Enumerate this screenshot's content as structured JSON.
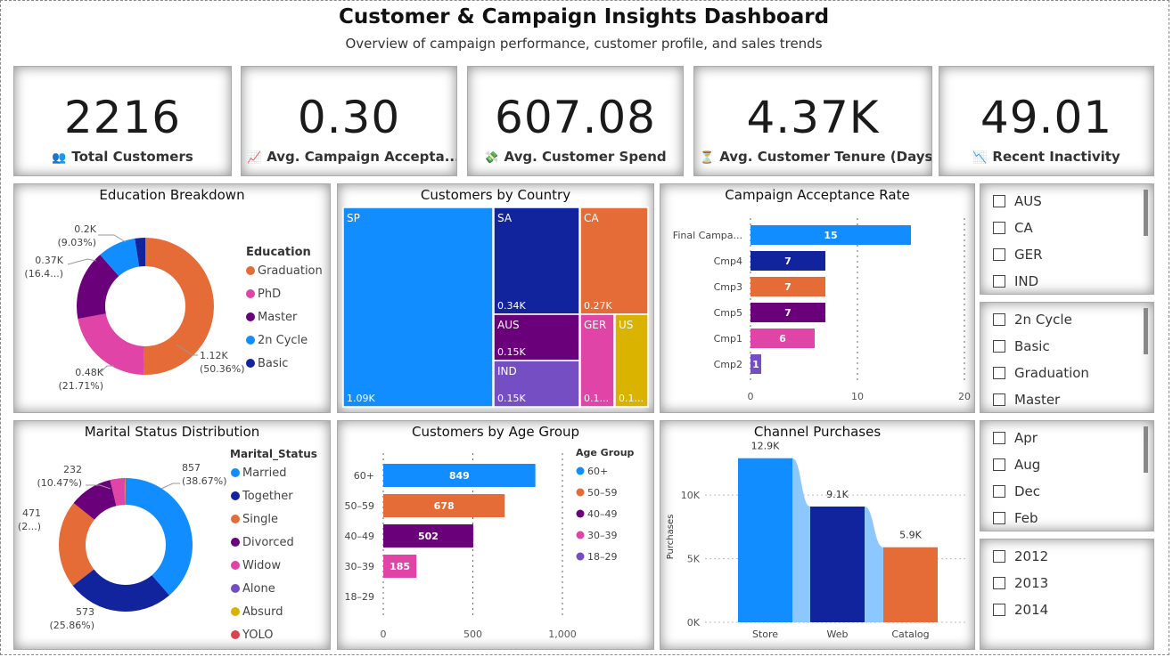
{
  "header": {
    "title": "Customer & Campaign Insights Dashboard",
    "subtitle": "Overview of campaign performance, customer profile, and sales trends"
  },
  "kpis": [
    {
      "value": "2216",
      "label": "Total Customers",
      "icon": "people-icon",
      "color": "#5b3a8c"
    },
    {
      "value": "0.30",
      "label": "Avg. Campaign Accepta...",
      "icon": "line-chart-icon",
      "color": "#4a78c9"
    },
    {
      "value": "607.08",
      "label": "Avg. Customer Spend",
      "icon": "money-icon",
      "color": "#3a9a3a"
    },
    {
      "value": "4.37K",
      "label": "Avg. Customer Tenure (Days)",
      "icon": "hourglass-icon",
      "color": "#c89b2a"
    },
    {
      "value": "49.01",
      "label": "Recent Inactivity",
      "icon": "trend-down-icon",
      "color": "#c0457a"
    }
  ],
  "education": {
    "title": "Education Breakdown",
    "legend_title": "Education",
    "legend": [
      "Graduation",
      "PhD",
      "Master",
      "2n Cycle",
      "Basic"
    ],
    "labels": [
      {
        "value": "1.12K",
        "pct": "(50.36%)"
      },
      {
        "value": "0.48K",
        "pct": "(21.71%)"
      },
      {
        "value": "0.37K",
        "pct": "(16.4...)"
      },
      {
        "value": "0.2K",
        "pct": "(9.03%)"
      }
    ],
    "chart_data": {
      "type": "pie",
      "categories": [
        "Graduation",
        "PhD",
        "Master",
        "2n Cycle",
        "Basic"
      ],
      "values": [
        1116,
        481,
        365,
        200,
        54
      ],
      "colors": [
        "#e66c37",
        "#e044a7",
        "#6b007b",
        "#118dff",
        "#12239e"
      ]
    }
  },
  "country": {
    "title": "Customers by Country",
    "chart_data": {
      "type": "treemap",
      "categories": [
        "SP",
        "SA",
        "CA",
        "AUS",
        "IND",
        "GER",
        "US"
      ],
      "labels": [
        "1.09K",
        "0.34K",
        "0.27K",
        "0.15K",
        "0.15K",
        "0.1...",
        "0.1..."
      ],
      "values": [
        1095,
        337,
        268,
        160,
        148,
        120,
        109
      ]
    }
  },
  "campaign": {
    "title": "Campaign Acceptance Rate",
    "chart_data": {
      "type": "bar",
      "categories": [
        "Final Campa...",
        "Cmp4",
        "Cmp3",
        "Cmp5",
        "Cmp1",
        "Cmp2"
      ],
      "values": [
        15,
        7,
        7,
        7,
        6,
        1
      ],
      "xticks": [
        "0",
        "10",
        "20"
      ],
      "xlim": [
        0,
        20
      ],
      "colors": [
        "#118dff",
        "#12239e",
        "#e66c37",
        "#6b007b",
        "#e044a7",
        "#744ec2"
      ]
    }
  },
  "slicer_country": {
    "items": [
      "AUS",
      "CA",
      "GER",
      "IND"
    ]
  },
  "slicer_education": {
    "items": [
      "2n Cycle",
      "Basic",
      "Graduation",
      "Master"
    ]
  },
  "slicer_month": {
    "items": [
      "Apr",
      "Aug",
      "Dec",
      "Feb"
    ]
  },
  "slicer_year": {
    "items": [
      "2012",
      "2013",
      "2014"
    ]
  },
  "marital": {
    "title": "Marital Status Distribution",
    "legend_title": "Marital_Status",
    "legend": [
      "Married",
      "Together",
      "Single",
      "Divorced",
      "Widow",
      "Alone",
      "Absurd",
      "YOLO"
    ],
    "legend_colors": [
      "#118dff",
      "#12239e",
      "#e66c37",
      "#6b007b",
      "#e044a7",
      "#744ec2",
      "#d9b300",
      "#d64550"
    ],
    "labels": [
      {
        "value": "857",
        "pct": "(38.67%)"
      },
      {
        "value": "573",
        "pct": "(25.86%)"
      },
      {
        "value": "471",
        "pct": "(2...)"
      },
      {
        "value": "232",
        "pct": "(10.47%)"
      }
    ],
    "chart_data": {
      "type": "pie",
      "categories": [
        "Married",
        "Together",
        "Single",
        "Divorced",
        "Widow",
        "Alone",
        "Absurd",
        "YOLO"
      ],
      "values": [
        857,
        573,
        471,
        232,
        76,
        3,
        2,
        2
      ],
      "colors": [
        "#118dff",
        "#12239e",
        "#e66c37",
        "#6b007b",
        "#e044a7",
        "#744ec2",
        "#d9b300",
        "#d64550"
      ]
    }
  },
  "age": {
    "title": "Customers by Age Group",
    "legend_title": "Age Group",
    "legend": [
      "60+",
      "50–59",
      "40–49",
      "30–39",
      "18–29"
    ],
    "legend_colors": [
      "#118dff",
      "#e66c37",
      "#6b007b",
      "#e044a7",
      "#744ec2"
    ],
    "chart_data": {
      "type": "bar",
      "categories": [
        "60+",
        "50–59",
        "40–49",
        "30–39",
        "18–29"
      ],
      "values": [
        849,
        678,
        502,
        185,
        0
      ],
      "xticks": [
        "0",
        "500",
        "1,000"
      ],
      "xlim": [
        0,
        1000
      ],
      "colors": [
        "#118dff",
        "#e66c37",
        "#6b007b",
        "#e044a7",
        "#744ec2"
      ]
    }
  },
  "channel": {
    "title": "Channel Purchases",
    "ylabel": "Purchases",
    "yticks": [
      "0K",
      "5K",
      "10K"
    ],
    "chart_data": {
      "type": "bar",
      "categories": [
        "Store",
        "Web",
        "Catalog"
      ],
      "values": [
        12.9,
        9.1,
        5.9
      ],
      "labels": [
        "12.9K",
        "9.1K",
        "5.9K"
      ],
      "ylim": [
        0,
        14
      ],
      "colors": [
        "#118dff",
        "#12239e",
        "#e66c37"
      ]
    }
  }
}
